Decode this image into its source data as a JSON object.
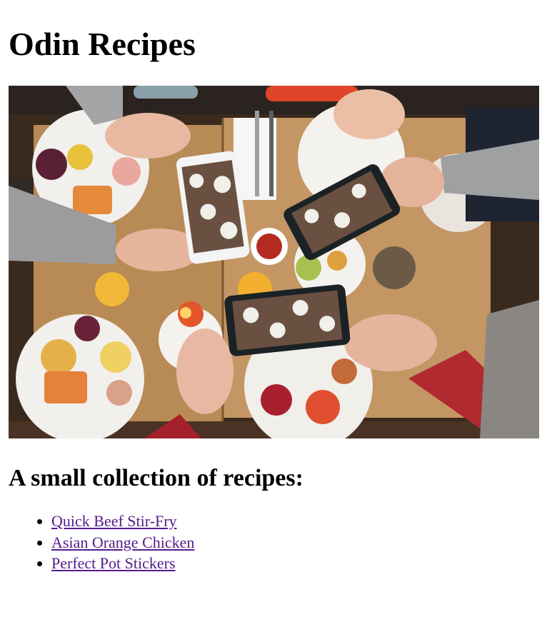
{
  "page": {
    "title": "Odin Recipes",
    "subtitle": "A small collection of recipes:"
  },
  "hero_image": {
    "description_icon": "food-photo-image"
  },
  "recipes": [
    {
      "label": "Quick Beef Stir-Fry"
    },
    {
      "label": "Asian Orange Chicken"
    },
    {
      "label": "Perfect Pot Stickers"
    }
  ],
  "colors": {
    "visited_link": "#551a8b",
    "text": "#000000"
  }
}
